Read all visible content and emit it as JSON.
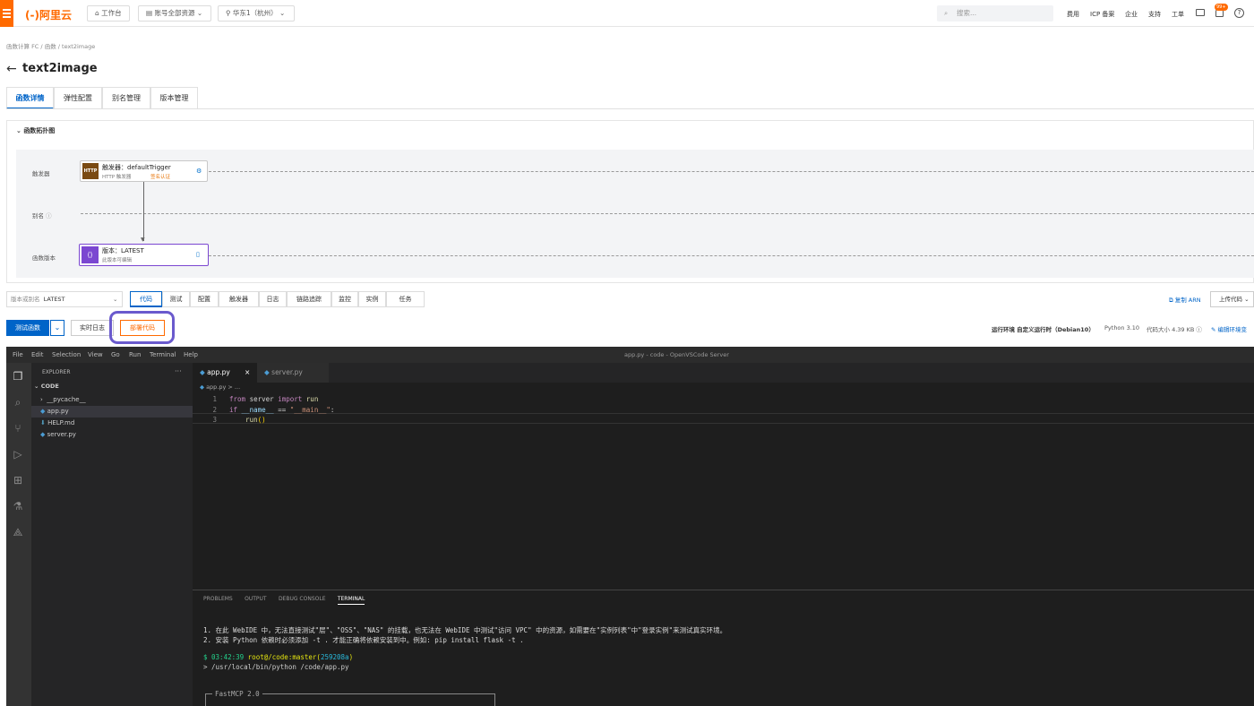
{
  "topbar": {
    "logo": "(-)阿里云",
    "workbench": "工作台",
    "account_resources": "账号全部资源",
    "region": "华东1（杭州）",
    "search_placeholder": "搜索...",
    "links": [
      "费用",
      "ICP 备案",
      "企业",
      "支持",
      "工单"
    ],
    "badge": "99+"
  },
  "breadcrumb": [
    "函数计算 FC",
    "函数",
    "text2image"
  ],
  "page_title": "text2image",
  "tabs": [
    "函数详情",
    "弹性配置",
    "别名管理",
    "版本管理"
  ],
  "topology": {
    "section_title": "函数拓扑图",
    "row_labels": [
      "触发器",
      "别名",
      "函数版本"
    ],
    "trigger_node": {
      "badge": "HTTP",
      "title": "触发器：defaultTrigger",
      "sub": "HTTP 触发器",
      "status": "签名认证"
    },
    "version_node": {
      "title": "版本：LATEST",
      "sub": "此版本可编辑"
    }
  },
  "code_toolbar": {
    "version_select_label": "版本或别名",
    "version_select_value": "LATEST",
    "tabs": [
      "代码",
      "测试",
      "配置",
      "触发器",
      "日志",
      "链路追踪",
      "监控",
      "实例",
      "任务"
    ],
    "copy_arn": "复制 ARN",
    "upload_code": "上传代码"
  },
  "actions": {
    "test_function": "测试函数",
    "realtime_log": "实时日志",
    "deploy_code": "部署代码",
    "runtime_label": "运行环境",
    "runtime_value": "自定义运行时（Debian10）",
    "python_version": "Python 3.10",
    "code_size": "代码大小 4.39 KB",
    "edit_env": "编辑环境变"
  },
  "ide": {
    "window_title": "app.py - code - OpenVSCode Server",
    "menu": [
      "File",
      "Edit",
      "Selection",
      "View",
      "Go",
      "Run",
      "Terminal",
      "Help"
    ],
    "explorer_title": "EXPLORER",
    "folder": "CODE",
    "files": [
      "__pycache__",
      "app.py",
      "HELP.md",
      "server.py"
    ],
    "editor_tabs": [
      "app.py",
      "server.py"
    ],
    "breadcrumb": "app.py > ...",
    "code_lines": [
      {
        "num": "1",
        "text": "from server import run"
      },
      {
        "num": "2",
        "text": "if __name__ == \"__main__\":"
      },
      {
        "num": "3",
        "text": "    run()"
      }
    ],
    "panel_tabs": [
      "PROBLEMS",
      "OUTPUT",
      "DEBUG CONSOLE",
      "TERMINAL"
    ],
    "terminal": {
      "note1": "1. 在此 WebIDE 中，无法直接测试\"层\"、\"OSS\"、\"NAS\" 的挂载，也无法在 WebIDE 中测试\"访问 VPC\" 中的资源，如需要在\"实例列表\"中\"登录实例\"来测试真实环境。",
      "note2": "2. 安装 Python 依赖时必须添加 -t . 才能正确将依赖安装到中。例如: pip install flask -t .",
      "prompt_time": "03:42:39",
      "prompt_user": "root@/code:master(",
      "prompt_hash": "259208a",
      "prompt_end": ")",
      "command": "> /usr/local/bin/python /code/app.py",
      "fastmcp": "FastMCP 2.0"
    }
  }
}
